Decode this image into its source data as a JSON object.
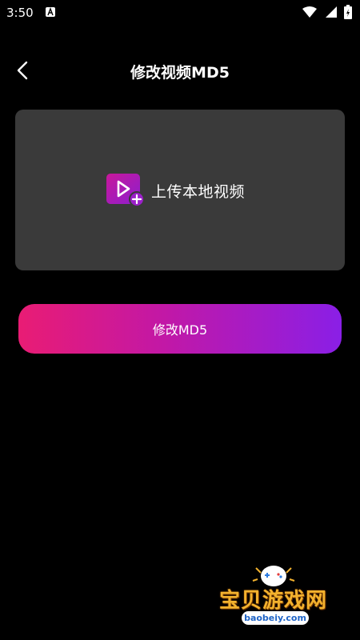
{
  "status_bar": {
    "time": "3:50"
  },
  "header": {
    "title": "修改视频MD5"
  },
  "upload": {
    "label": "上传本地视频"
  },
  "actions": {
    "modify_label": "修改MD5"
  },
  "watermark": {
    "text": "宝贝游戏网",
    "url": "baobeiy.com"
  },
  "colors": {
    "background": "#000000",
    "card": "#3a3a3a",
    "gradient_start": "#e91c74",
    "gradient_end": "#8a1fe6",
    "icon_magenta": "#b5179e"
  },
  "icons": [
    "back-arrow-icon",
    "video-upload-icon",
    "wifi-icon",
    "signal-icon",
    "battery-icon"
  ]
}
